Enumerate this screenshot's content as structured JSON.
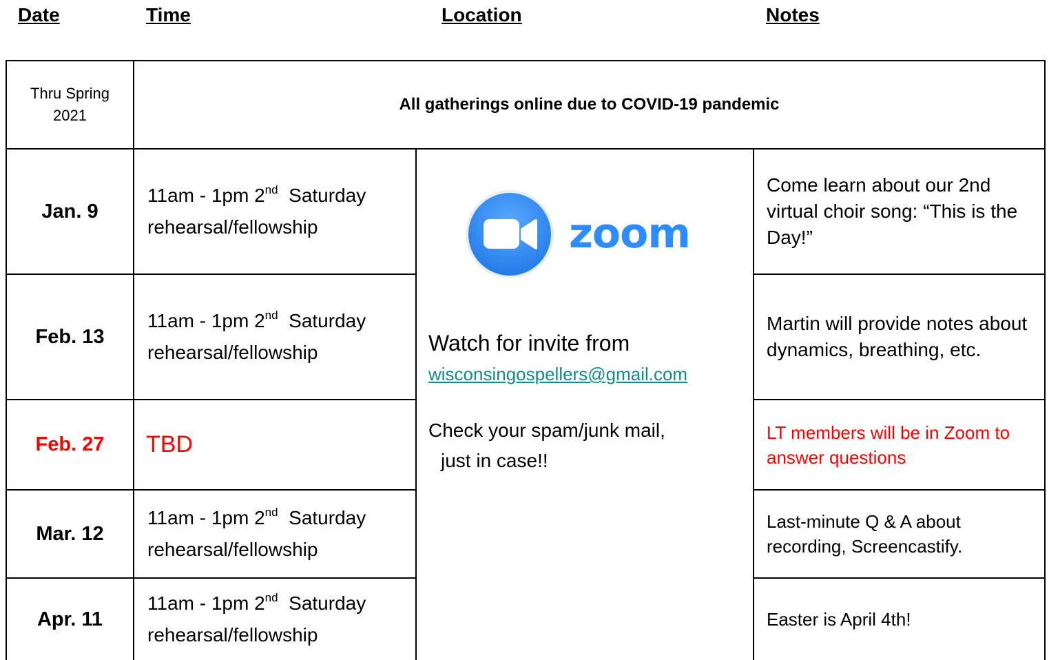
{
  "headers": {
    "date": "Date",
    "time": "Time",
    "location": "Location",
    "notes": "Notes"
  },
  "banner": {
    "period": "Thru Spring 2021",
    "message": "All gatherings online due to COVID-19 pandemic"
  },
  "rows": [
    {
      "date": "Jan. 9",
      "time_prefix": "11am - 1pm 2",
      "time_sup": "nd",
      "time_suffix": "  Saturday",
      "time_line2": "rehearsal/fellowship",
      "note": "Come learn about our 2nd virtual choir song: “This is the Day!”"
    },
    {
      "date": "Feb. 13",
      "time_prefix": "11am - 1pm 2",
      "time_sup": "nd",
      "time_suffix": "  Saturday",
      "time_line2": "rehearsal/fellowship",
      "note": "Martin will provide notes about dynamics, breathing, etc."
    },
    {
      "date": "Feb. 27",
      "time": "TBD",
      "note": "LT members will be in Zoom to answer questions"
    },
    {
      "date": "Mar. 12",
      "time_prefix": "11am - 1pm 2",
      "time_sup": "nd",
      "time_suffix": "  Saturday",
      "time_line2": "rehearsal/fellowship",
      "note": "Last-minute Q & A about recording, Screencastify."
    },
    {
      "date": "Apr. 11",
      "time_prefix": "11am - 1pm 2",
      "time_sup": "nd",
      "time_suffix": "  Saturday",
      "time_line2": "rehearsal/fellowship",
      "note": "Easter is April 4th!"
    }
  ],
  "location": {
    "logo_word": "zoom",
    "invite_text": "Watch for invite from",
    "email": "wisconsingospellers@gmail.com",
    "spam_line1": "Check your spam/junk mail,",
    "spam_line2": "just in case!!"
  },
  "colors": {
    "highlight_red": "#ff0000",
    "zoom_blue": "#2d8cff",
    "link_teal": "#0f8c8c"
  },
  "icons": {
    "zoom_logo": "zoom-camera-icon"
  }
}
